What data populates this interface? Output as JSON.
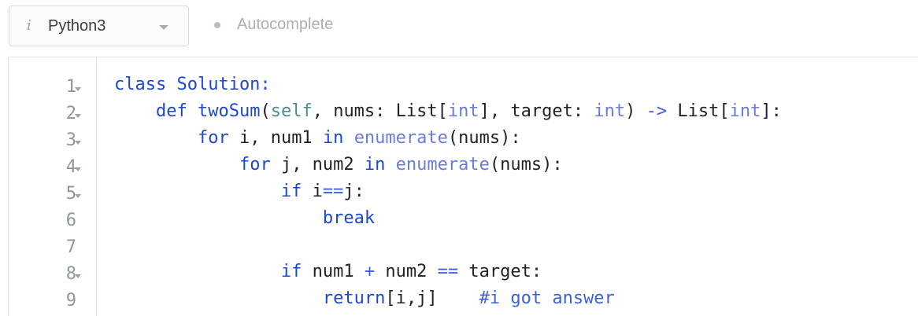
{
  "toolbar": {
    "info_icon": "i",
    "language": "Python3",
    "autocomplete_label": "Autocomplete"
  },
  "editor": {
    "lines": [
      {
        "number": "1",
        "foldable": true
      },
      {
        "number": "2",
        "foldable": true
      },
      {
        "number": "3",
        "foldable": true
      },
      {
        "number": "4",
        "foldable": true
      },
      {
        "number": "5",
        "foldable": true
      },
      {
        "number": "6",
        "foldable": false
      },
      {
        "number": "7",
        "foldable": false
      },
      {
        "number": "8",
        "foldable": true
      },
      {
        "number": "9",
        "foldable": false
      }
    ],
    "code": [
      [
        {
          "t": "class Solution:",
          "c": "kwfirst"
        }
      ],
      [
        {
          "t": "    "
        },
        {
          "t": "def",
          "c": "kw"
        },
        {
          "t": " "
        },
        {
          "t": "twoSum",
          "c": "fn"
        },
        {
          "t": "("
        },
        {
          "t": "self",
          "c": "self"
        },
        {
          "t": ", nums: List["
        },
        {
          "t": "int",
          "c": "builtin"
        },
        {
          "t": "], target: "
        },
        {
          "t": "int",
          "c": "builtin"
        },
        {
          "t": ") "
        },
        {
          "t": "->",
          "c": "op"
        },
        {
          "t": " List["
        },
        {
          "t": "int",
          "c": "builtin"
        },
        {
          "t": "]:"
        }
      ],
      [
        {
          "t": "        "
        },
        {
          "t": "for",
          "c": "kw"
        },
        {
          "t": " i, num1 "
        },
        {
          "t": "in",
          "c": "kw"
        },
        {
          "t": " "
        },
        {
          "t": "enumerate",
          "c": "builtin"
        },
        {
          "t": "(nums):"
        }
      ],
      [
        {
          "t": "            "
        },
        {
          "t": "for",
          "c": "kw"
        },
        {
          "t": " j, num2 "
        },
        {
          "t": "in",
          "c": "kw"
        },
        {
          "t": " "
        },
        {
          "t": "enumerate",
          "c": "builtin"
        },
        {
          "t": "(nums):"
        }
      ],
      [
        {
          "t": "                "
        },
        {
          "t": "if",
          "c": "kw"
        },
        {
          "t": " i"
        },
        {
          "t": "==",
          "c": "op"
        },
        {
          "t": "j:"
        }
      ],
      [
        {
          "t": "                    "
        },
        {
          "t": "break",
          "c": "kw"
        }
      ],
      [
        {
          "t": ""
        }
      ],
      [
        {
          "t": "                "
        },
        {
          "t": "if",
          "c": "kw"
        },
        {
          "t": " num1 "
        },
        {
          "t": "+",
          "c": "op"
        },
        {
          "t": " num2 "
        },
        {
          "t": "==",
          "c": "op"
        },
        {
          "t": " target:"
        }
      ],
      [
        {
          "t": "                    "
        },
        {
          "t": "return",
          "c": "kw"
        },
        {
          "t": "[i,j]    "
        },
        {
          "t": "#i got answer",
          "c": "cm"
        }
      ]
    ]
  }
}
